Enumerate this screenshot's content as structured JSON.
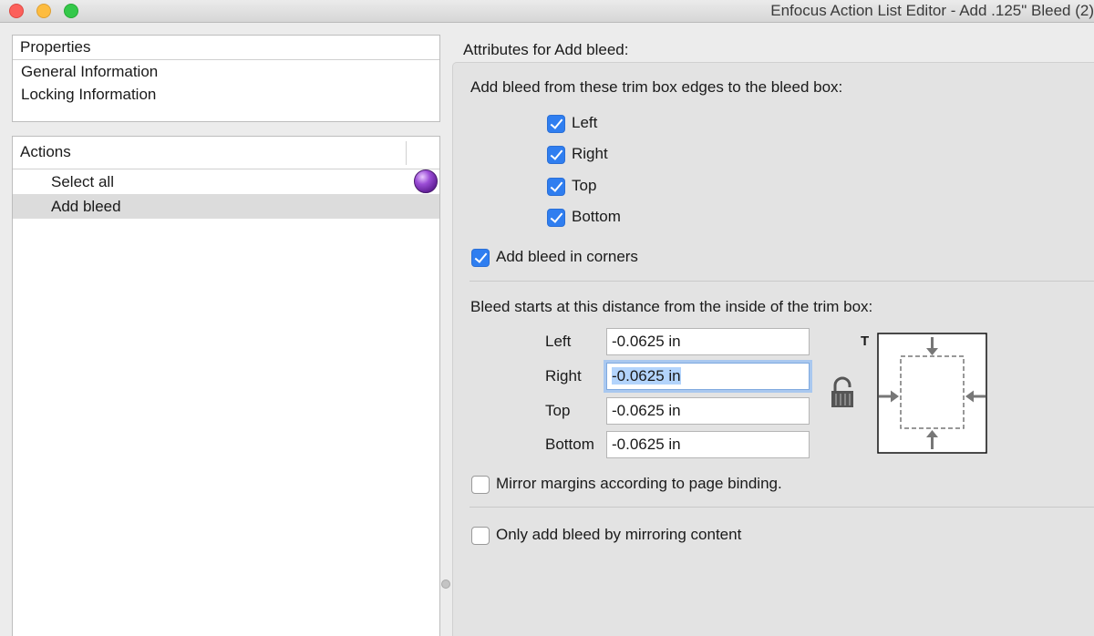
{
  "window": {
    "title": "Enfocus Action List Editor - Add .125\" Bleed (2)"
  },
  "properties": {
    "header": "Properties",
    "items": [
      "General Information",
      "Locking Information"
    ]
  },
  "actions": {
    "header": "Actions",
    "items": [
      "Select all",
      "Add bleed"
    ]
  },
  "attributes": {
    "title": "Attributes for Add bleed:",
    "edges_label": "Add bleed from these trim box edges to the bleed box:",
    "edges": [
      {
        "label": "Left",
        "checked": true
      },
      {
        "label": "Right",
        "checked": true
      },
      {
        "label": "Top",
        "checked": true
      },
      {
        "label": "Bottom",
        "checked": true
      }
    ],
    "corners_label": "Add bleed in corners",
    "distance_label": "Bleed starts at this distance from the inside of the trim box:",
    "distances": [
      {
        "label": "Left",
        "value": "-0.0625 in"
      },
      {
        "label": "Right",
        "value": "-0.0625 in"
      },
      {
        "label": "Top",
        "value": "-0.0625 in"
      },
      {
        "label": "Bottom",
        "value": "-0.0625 in"
      }
    ],
    "diagram_label": "T",
    "mirror_label": "Mirror margins according to page binding.",
    "only_mirror_label": "Only add bleed by mirroring content"
  },
  "colors": {
    "accent": "#2f7ef0",
    "selection": "#b3d4fc"
  },
  "icons": [
    "lock-icon",
    "bleed-diagram-icon",
    "orb-icon"
  ]
}
